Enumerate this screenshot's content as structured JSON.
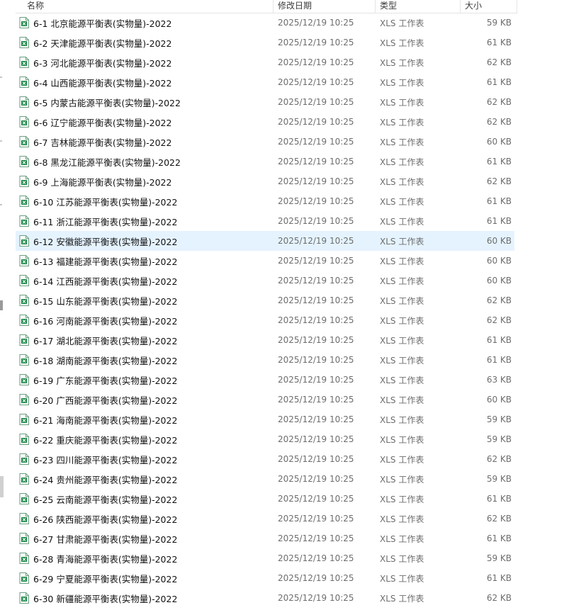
{
  "columns": {
    "name": "名称",
    "date": "修改日期",
    "type": "类型",
    "size": "大小"
  },
  "icon": "xls-file-icon",
  "colors": {
    "selected_row": "#e5f3ff",
    "icon_green": "#1e8a4a"
  },
  "files": [
    {
      "name": "6-1 北京能源平衡表(实物量)-2022",
      "date": "2025/12/19 10:25",
      "type": "XLS 工作表",
      "size": "59 KB"
    },
    {
      "name": "6-2 天津能源平衡表(实物量)-2022",
      "date": "2025/12/19 10:25",
      "type": "XLS 工作表",
      "size": "61 KB"
    },
    {
      "name": "6-3 河北能源平衡表(实物量)-2022",
      "date": "2025/12/19 10:25",
      "type": "XLS 工作表",
      "size": "62 KB"
    },
    {
      "name": "6-4 山西能源平衡表(实物量)-2022",
      "date": "2025/12/19 10:25",
      "type": "XLS 工作表",
      "size": "61 KB"
    },
    {
      "name": "6-5 内蒙古能源平衡表(实物量)-2022",
      "date": "2025/12/19 10:25",
      "type": "XLS 工作表",
      "size": "62 KB"
    },
    {
      "name": "6-6 辽宁能源平衡表(实物量)-2022",
      "date": "2025/12/19 10:25",
      "type": "XLS 工作表",
      "size": "62 KB"
    },
    {
      "name": "6-7 吉林能源平衡表(实物量)-2022",
      "date": "2025/12/19 10:25",
      "type": "XLS 工作表",
      "size": "60 KB"
    },
    {
      "name": "6-8 黑龙江能源平衡表(实物量)-2022",
      "date": "2025/12/19 10:25",
      "type": "XLS 工作表",
      "size": "61 KB"
    },
    {
      "name": "6-9 上海能源平衡表(实物量)-2022",
      "date": "2025/12/19 10:25",
      "type": "XLS 工作表",
      "size": "62 KB"
    },
    {
      "name": "6-10 江苏能源平衡表(实物量)-2022",
      "date": "2025/12/19 10:25",
      "type": "XLS 工作表",
      "size": "61 KB"
    },
    {
      "name": "6-11 浙江能源平衡表(实物量)-2022",
      "date": "2025/12/19 10:25",
      "type": "XLS 工作表",
      "size": "61 KB"
    },
    {
      "name": "6-12 安徽能源平衡表(实物量)-2022",
      "date": "2025/12/19 10:25",
      "type": "XLS 工作表",
      "size": "60 KB",
      "selected": true
    },
    {
      "name": "6-13 福建能源平衡表(实物量)-2022",
      "date": "2025/12/19 10:25",
      "type": "XLS 工作表",
      "size": "60 KB"
    },
    {
      "name": "6-14 江西能源平衡表(实物量)-2022",
      "date": "2025/12/19 10:25",
      "type": "XLS 工作表",
      "size": "60 KB"
    },
    {
      "name": "6-15 山东能源平衡表(实物量)-2022",
      "date": "2025/12/19 10:25",
      "type": "XLS 工作表",
      "size": "62 KB"
    },
    {
      "name": "6-16 河南能源平衡表(实物量)-2022",
      "date": "2025/12/19 10:25",
      "type": "XLS 工作表",
      "size": "62 KB"
    },
    {
      "name": "6-17 湖北能源平衡表(实物量)-2022",
      "date": "2025/12/19 10:25",
      "type": "XLS 工作表",
      "size": "61 KB"
    },
    {
      "name": "6-18 湖南能源平衡表(实物量)-2022",
      "date": "2025/12/19 10:25",
      "type": "XLS 工作表",
      "size": "61 KB"
    },
    {
      "name": "6-19 广东能源平衡表(实物量)-2022",
      "date": "2025/12/19 10:25",
      "type": "XLS 工作表",
      "size": "63 KB"
    },
    {
      "name": "6-20 广西能源平衡表(实物量)-2022",
      "date": "2025/12/19 10:25",
      "type": "XLS 工作表",
      "size": "60 KB"
    },
    {
      "name": "6-21 海南能源平衡表(实物量)-2022",
      "date": "2025/12/19 10:25",
      "type": "XLS 工作表",
      "size": "59 KB"
    },
    {
      "name": "6-22 重庆能源平衡表(实物量)-2022",
      "date": "2025/12/19 10:25",
      "type": "XLS 工作表",
      "size": "59 KB"
    },
    {
      "name": "6-23 四川能源平衡表(实物量)-2022",
      "date": "2025/12/19 10:25",
      "type": "XLS 工作表",
      "size": "62 KB"
    },
    {
      "name": "6-24 贵州能源平衡表(实物量)-2022",
      "date": "2025/12/19 10:25",
      "type": "XLS 工作表",
      "size": "59 KB"
    },
    {
      "name": "6-25 云南能源平衡表(实物量)-2022",
      "date": "2025/12/19 10:25",
      "type": "XLS 工作表",
      "size": "61 KB"
    },
    {
      "name": "6-26 陕西能源平衡表(实物量)-2022",
      "date": "2025/12/19 10:25",
      "type": "XLS 工作表",
      "size": "62 KB"
    },
    {
      "name": "6-27 甘肃能源平衡表(实物量)-2022",
      "date": "2025/12/19 10:25",
      "type": "XLS 工作表",
      "size": "61 KB"
    },
    {
      "name": "6-28 青海能源平衡表(实物量)-2022",
      "date": "2025/12/19 10:25",
      "type": "XLS 工作表",
      "size": "59 KB"
    },
    {
      "name": "6-29 宁夏能源平衡表(实物量)-2022",
      "date": "2025/12/19 10:25",
      "type": "XLS 工作表",
      "size": "61 KB"
    },
    {
      "name": "6-30 新疆能源平衡表(实物量)-2022",
      "date": "2025/12/19 10:25",
      "type": "XLS 工作表",
      "size": "62 KB"
    }
  ]
}
